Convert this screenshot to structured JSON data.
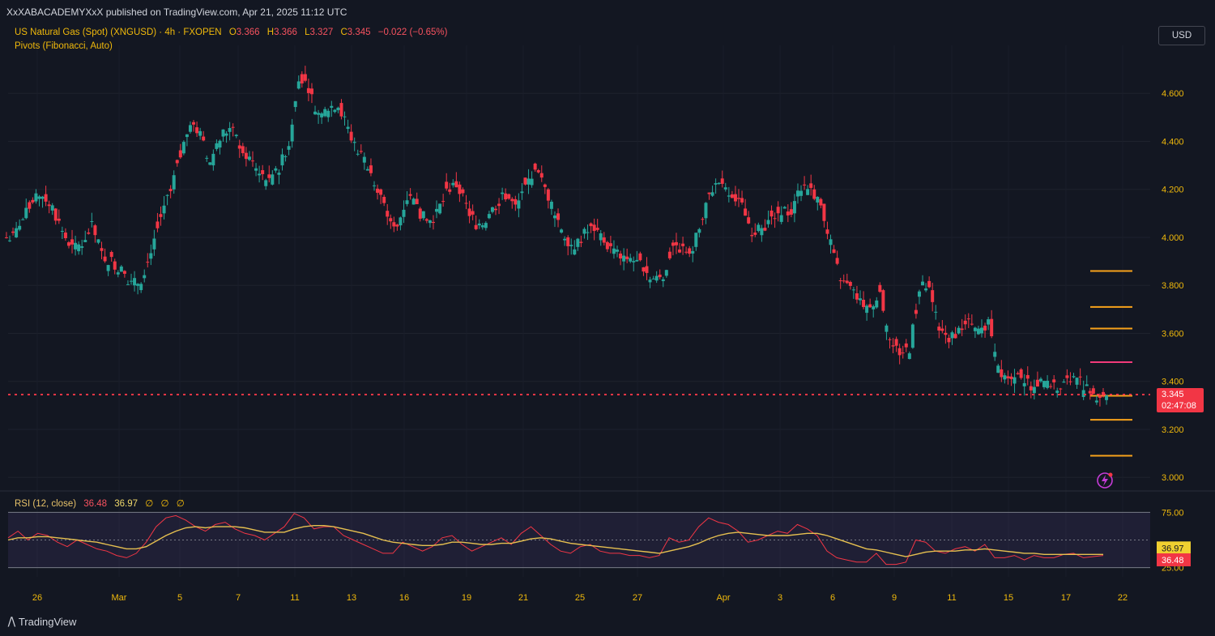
{
  "header": {
    "publisher": "XxXABACADEMYXxX published on TradingView.com, Apr 21, 2025 11:12 UTC"
  },
  "legend": {
    "symbol": "US Natural Gas (Spot) (XNGUSD) · 4h · FXOPEN",
    "o_label": "O",
    "o": "3.366",
    "h_label": "H",
    "h": "3.366",
    "l_label": "L",
    "l": "3.327",
    "c_label": "C",
    "c": "3.345",
    "change": "−0.022 (−0.65%)",
    "pivots": "Pivots (Fibonacci, Auto)"
  },
  "currency_button": "USD",
  "footer": {
    "brand": "TradingView",
    "logo_icon": "tradingview-logo-icon"
  },
  "colors": {
    "up": "#26a69a",
    "down": "#f23645",
    "pivot_orange": "#f7a21b",
    "pivot_pink": "#f23a7a",
    "rsi_line": "#f23645",
    "rsi_ma": "#e6c050",
    "axis_text": "#f0b90b"
  },
  "chart_data": [
    {
      "type": "candlestick",
      "x_ticks": [
        "26",
        "Mar",
        "5",
        "7",
        "11",
        "13",
        "16",
        "19",
        "21",
        "25",
        "27",
        "Apr",
        "3",
        "6",
        "9",
        "11",
        "15",
        "17",
        "22"
      ],
      "y_ticks": [
        "3.000",
        "3.200",
        "3.400",
        "3.600",
        "3.800",
        "4.000",
        "4.200",
        "4.400",
        "4.600"
      ],
      "ylim": [
        2.95,
        4.8
      ],
      "last_price": {
        "value": "3.345",
        "countdown": "02:47:08"
      },
      "pivots": [
        {
          "value": 3.86,
          "color": "orange"
        },
        {
          "value": 3.71,
          "color": "orange"
        },
        {
          "value": 3.62,
          "color": "orange"
        },
        {
          "value": 3.48,
          "color": "pink"
        },
        {
          "value": 3.34,
          "color": "orange"
        },
        {
          "value": 3.24,
          "color": "orange"
        },
        {
          "value": 3.09,
          "color": "orange"
        }
      ],
      "close_path": [
        4.0,
        4.08,
        4.15,
        4.18,
        4.12,
        4.02,
        3.95,
        3.98,
        4.05,
        3.92,
        3.9,
        3.86,
        3.8,
        3.83,
        3.95,
        4.1,
        4.2,
        4.35,
        4.48,
        4.42,
        4.3,
        4.42,
        4.46,
        4.38,
        4.32,
        4.28,
        4.22,
        4.3,
        4.4,
        4.68,
        4.62,
        4.5,
        4.54,
        4.56,
        4.44,
        4.36,
        4.3,
        4.2,
        4.08,
        4.05,
        4.18,
        4.12,
        4.06,
        4.1,
        4.2,
        4.22,
        4.12,
        4.05,
        4.08,
        4.14,
        4.18,
        4.12,
        4.22,
        4.28,
        4.2,
        4.1,
        4.0,
        3.96,
        4.02,
        4.04,
        3.98,
        3.94,
        3.92,
        3.9,
        3.88,
        3.82,
        3.84,
        3.98,
        3.94,
        3.96,
        4.08,
        4.22,
        4.2,
        4.18,
        4.12,
        4.02,
        4.04,
        4.08,
        4.12,
        4.1,
        4.22,
        4.2,
        4.14,
        3.95,
        3.82,
        3.78,
        3.74,
        3.7,
        3.78,
        3.55,
        3.52,
        3.54,
        3.8,
        3.78,
        3.62,
        3.58,
        3.62,
        3.64,
        3.6,
        3.66,
        3.45,
        3.42,
        3.45,
        3.38,
        3.4,
        3.38,
        3.37,
        3.4,
        3.42,
        3.36,
        3.34,
        3.35
      ],
      "volatility_hint": "candles derived from close path"
    },
    {
      "type": "line",
      "title": "RSI (12, close)",
      "values_label": [
        "36.48",
        "36.97",
        "∅",
        "∅",
        "∅"
      ],
      "y_ticks": [
        "75.00",
        "25.00"
      ],
      "ylim": [
        5,
        95
      ],
      "upper_band": 75,
      "lower_band": 25,
      "mid": 50,
      "rsi_value": "36.48",
      "ma_value": "36.97",
      "series": [
        {
          "values": [
            52,
            58,
            50,
            56,
            54,
            48,
            44,
            50,
            46,
            42,
            40,
            36,
            34,
            38,
            48,
            62,
            70,
            72,
            68,
            62,
            58,
            64,
            66,
            60,
            56,
            54,
            50,
            56,
            62,
            74,
            70,
            60,
            62,
            62,
            54,
            50,
            46,
            42,
            38,
            38,
            48,
            44,
            40,
            44,
            52,
            54,
            46,
            40,
            44,
            48,
            52,
            46,
            56,
            62,
            54,
            46,
            40,
            38,
            44,
            46,
            40,
            38,
            38,
            36,
            36,
            34,
            36,
            52,
            48,
            50,
            62,
            70,
            66,
            64,
            58,
            48,
            50,
            54,
            58,
            56,
            64,
            60,
            54,
            40,
            34,
            32,
            30,
            30,
            38,
            28,
            28,
            30,
            50,
            48,
            40,
            38,
            42,
            44,
            40,
            46,
            34,
            34,
            36,
            32,
            36,
            34,
            34,
            37,
            38,
            34,
            35,
            36
          ]
        },
        {
          "values": [
            50,
            52,
            52,
            53,
            53,
            52,
            51,
            50,
            49,
            48,
            46,
            44,
            42,
            42,
            44,
            49,
            54,
            58,
            61,
            62,
            61,
            62,
            62,
            62,
            61,
            59,
            57,
            57,
            57,
            60,
            62,
            63,
            63,
            62,
            60,
            58,
            56,
            53,
            50,
            48,
            47,
            46,
            45,
            45,
            46,
            48,
            48,
            47,
            46,
            46,
            47,
            47,
            49,
            51,
            52,
            51,
            49,
            47,
            46,
            45,
            44,
            43,
            42,
            41,
            40,
            39,
            38,
            40,
            42,
            44,
            47,
            51,
            54,
            56,
            57,
            56,
            55,
            54,
            54,
            54,
            55,
            56,
            56,
            54,
            51,
            48,
            45,
            42,
            41,
            39,
            37,
            35,
            37,
            39,
            40,
            40,
            40,
            41,
            41,
            42,
            41,
            40,
            39,
            38,
            38,
            37,
            37,
            37,
            37,
            37,
            37,
            37
          ]
        }
      ]
    }
  ]
}
